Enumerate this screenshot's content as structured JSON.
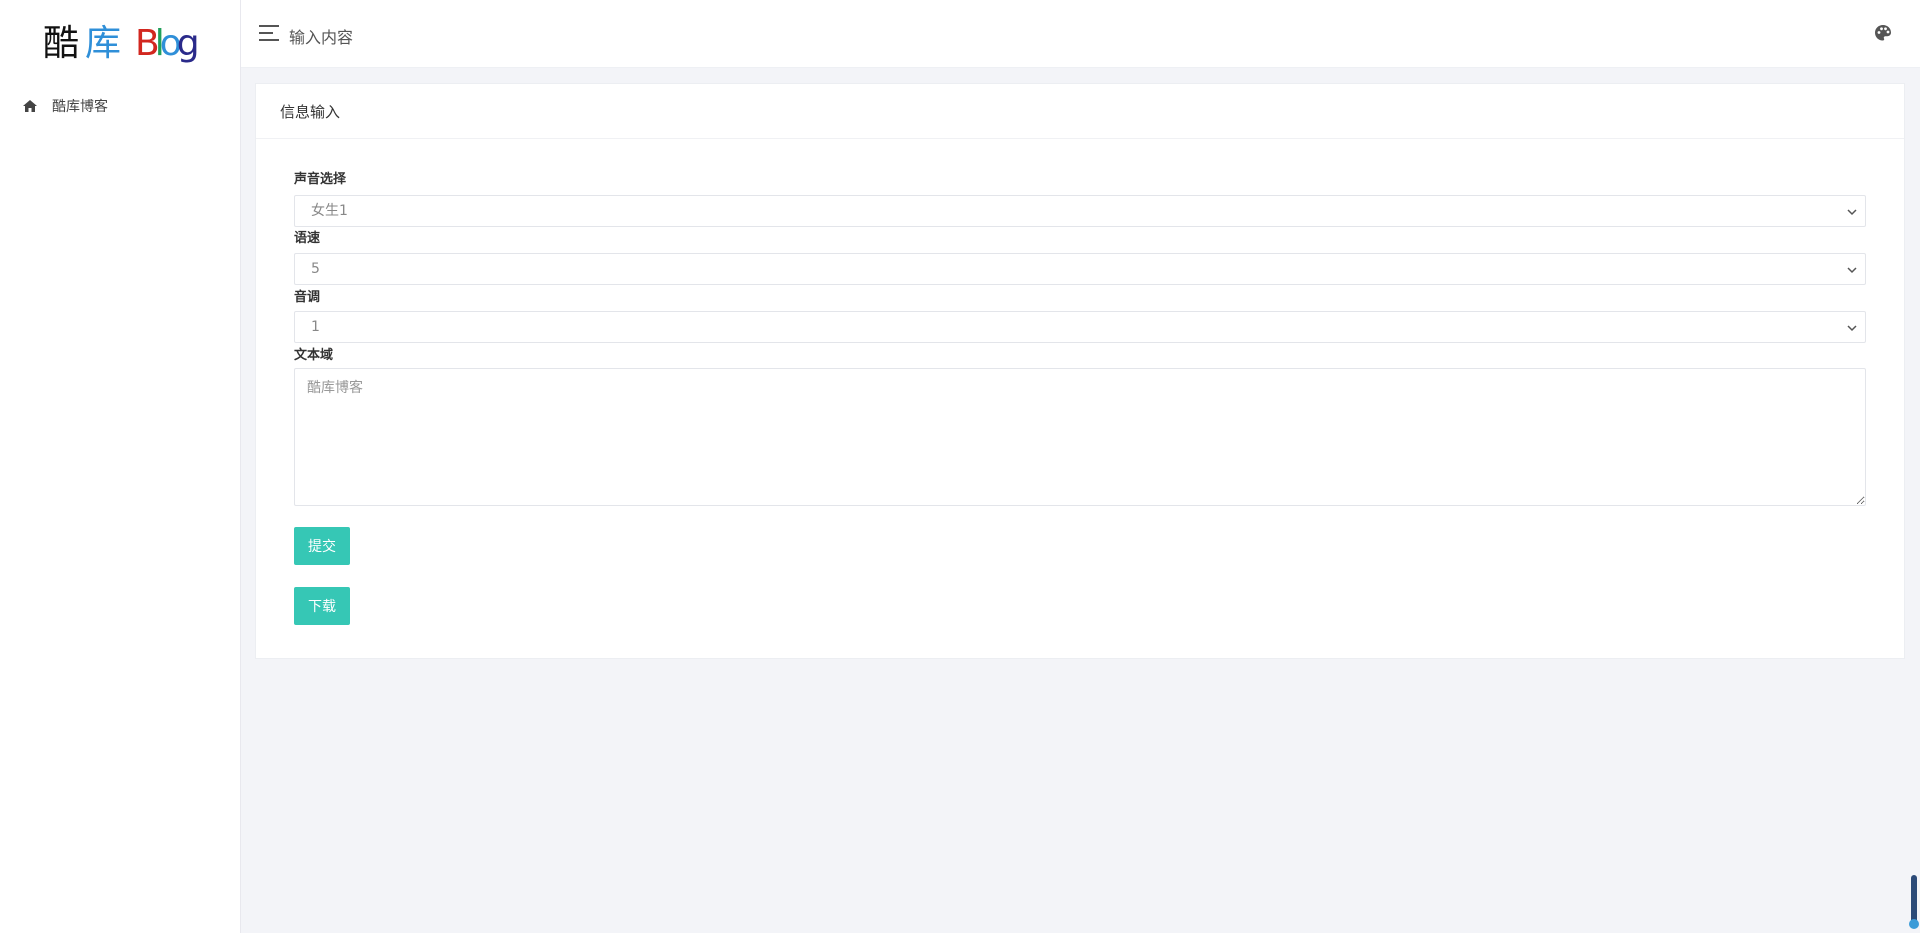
{
  "sidebar": {
    "logo": {
      "cn1": "酷",
      "cn2": "库",
      "b": "B",
      "l": "l",
      "o": "o",
      "g": "g"
    },
    "items": [
      {
        "label": "酷库博客",
        "icon": "home-icon"
      }
    ]
  },
  "header": {
    "title": "输入内容",
    "right_icon": "palette-icon"
  },
  "card": {
    "title": "信息输入",
    "voice": {
      "label": "声音选择",
      "value": "女生1"
    },
    "speed": {
      "label": "语速",
      "value": "5"
    },
    "pitch": {
      "label": "音调",
      "value": "1"
    },
    "text": {
      "label": "文本域",
      "placeholder": "酷库博客"
    },
    "submit_label": "提交",
    "download_label": "下载"
  },
  "colors": {
    "accent": "#36c7b5",
    "background": "#f3f4f8"
  }
}
